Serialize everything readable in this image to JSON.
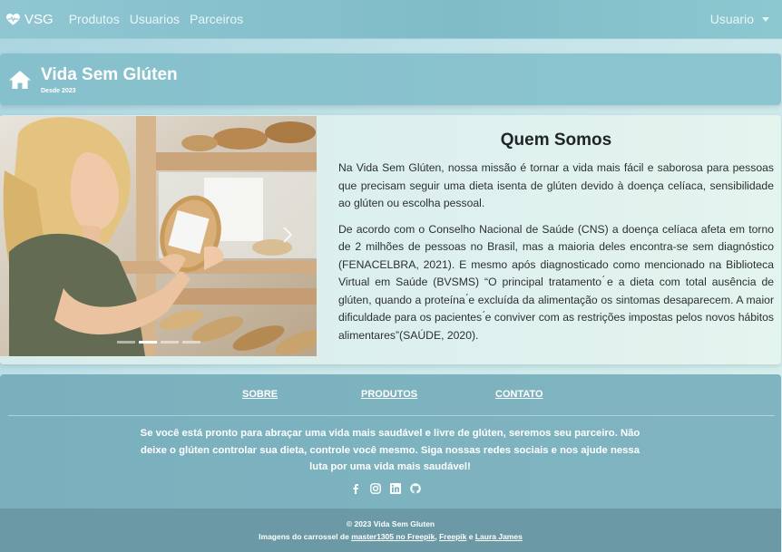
{
  "navbar": {
    "brand": "VSG",
    "links": [
      "Produtos",
      "Usuarios",
      "Parceiros"
    ],
    "user_menu": "Usuario",
    "brand_icon": "heart-pulse-icon"
  },
  "banner": {
    "title": "Vida Sem Glúten",
    "subtitle": "Desde 2023",
    "icon": "home-icon"
  },
  "about": {
    "title": "Quem Somos",
    "paragraphs": [
      "Na Vida Sem Glúten, nossa missão é tornar a vida mais fácil e saborosa para pessoas que precisam seguir uma dieta isenta de glúten devido à doença celíaca, sensibilidade ao glúten ou escolha pessoal.",
      "De acordo com o Conselho Nacional de Saúde (CNS) a doença celíaca afeta em torno de 2 milhões de pessoas no Brasil, mas a maioria deles encontra-se sem diagnóstico (FENACELBRA, 2021). E mesmo após diagnosticado como mencionado na Biblioteca Virtual em Saúde (BVSMS) “O principal tratamento ́e a dieta com total ausência de glúten, quando a proteína ́e excluída da alimentação os sintomas desaparecem. A maior dificuldade para os pacientes ́e conviver com as restrições impostas pelos novos hábitos alimentares”(SAÚDE, 2020)."
    ]
  },
  "carousel": {
    "slide_count": 4,
    "active_index": 1,
    "next_icon": "chevron-right-icon"
  },
  "footer": {
    "links": [
      "SOBRE",
      "PRODUTOS",
      "CONTATO"
    ],
    "text": "Se você está pronto para abraçar uma vida mais saudável e livre de glúten, seremos seu parceiro. Não deixe o glúten controlar sua dieta, controle você mesmo. Siga nossas redes sociais e nos ajude nessa luta por uma vida mais saudável!",
    "socials": [
      "facebook-icon",
      "instagram-icon",
      "linkedin-icon",
      "github-icon"
    ],
    "copyright": "© 2023 Vida Sem Gluten",
    "credits_prefix": "Imagens do carrossel de",
    "credit_1": "master1305 no Freepik",
    "credit_sep_1": ",",
    "credit_2": "Freepik",
    "credit_sep_2": "e",
    "credit_3": "Laura James"
  }
}
